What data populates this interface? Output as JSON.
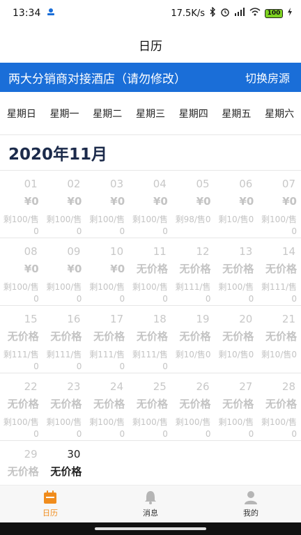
{
  "status_bar": {
    "time": "13:34",
    "network_speed": "17.5K/s",
    "battery": "100"
  },
  "nav": {
    "title": "日历"
  },
  "hotel": {
    "name": "两大分销商对接酒店（请勿修改）",
    "switch_label": "切换房源"
  },
  "weekdays": [
    "星期日",
    "星期一",
    "星期二",
    "星期三",
    "星期四",
    "星期五",
    "星期六"
  ],
  "month_title": "2020年11月",
  "days": [
    {
      "num": "01",
      "price": "¥0",
      "stock": "剩100/售0"
    },
    {
      "num": "02",
      "price": "¥0",
      "stock": "剩100/售0"
    },
    {
      "num": "03",
      "price": "¥0",
      "stock": "剩100/售0"
    },
    {
      "num": "04",
      "price": "¥0",
      "stock": "剩100/售0"
    },
    {
      "num": "05",
      "price": "¥0",
      "stock": "剩98/售0"
    },
    {
      "num": "06",
      "price": "¥0",
      "stock": "剩10/售0"
    },
    {
      "num": "07",
      "price": "¥0",
      "stock": "剩100/售0"
    },
    {
      "num": "08",
      "price": "¥0",
      "stock": "剩100/售0"
    },
    {
      "num": "09",
      "price": "¥0",
      "stock": "剩100/售0"
    },
    {
      "num": "10",
      "price": "¥0",
      "stock": "剩100/售0"
    },
    {
      "num": "11",
      "price": "无价格",
      "stock": "剩100/售0"
    },
    {
      "num": "12",
      "price": "无价格",
      "stock": "剩111/售0"
    },
    {
      "num": "13",
      "price": "无价格",
      "stock": "剩100/售0"
    },
    {
      "num": "14",
      "price": "无价格",
      "stock": "剩111/售0"
    },
    {
      "num": "15",
      "price": "无价格",
      "stock": "剩111/售0"
    },
    {
      "num": "16",
      "price": "无价格",
      "stock": "剩111/售0"
    },
    {
      "num": "17",
      "price": "无价格",
      "stock": "剩111/售0"
    },
    {
      "num": "18",
      "price": "无价格",
      "stock": "剩111/售0"
    },
    {
      "num": "19",
      "price": "无价格",
      "stock": "剩10/售0"
    },
    {
      "num": "20",
      "price": "无价格",
      "stock": "剩10/售0"
    },
    {
      "num": "21",
      "price": "无价格",
      "stock": "剩10/售0"
    },
    {
      "num": "22",
      "price": "无价格",
      "stock": "剩100/售0"
    },
    {
      "num": "23",
      "price": "无价格",
      "stock": "剩100/售0"
    },
    {
      "num": "24",
      "price": "无价格",
      "stock": "剩100/售0"
    },
    {
      "num": "25",
      "price": "无价格",
      "stock": "剩100/售0"
    },
    {
      "num": "26",
      "price": "无价格",
      "stock": "剩100/售0"
    },
    {
      "num": "27",
      "price": "无价格",
      "stock": "剩100/售0"
    },
    {
      "num": "28",
      "price": "无价格",
      "stock": "剩100/售0"
    },
    {
      "num": "29",
      "price": "无价格",
      "stock": ""
    },
    {
      "num": "30",
      "price": "无价格",
      "stock": "",
      "active": true
    }
  ],
  "tabs": [
    {
      "label": "日历",
      "icon": "calendar-icon",
      "active": true
    },
    {
      "label": "消息",
      "icon": "bell-icon",
      "active": false
    },
    {
      "label": "我的",
      "icon": "user-icon",
      "active": false
    }
  ],
  "colors": {
    "primary_blue": "#1a6ed8",
    "tab_active": "#f08c1c",
    "title_navy": "#1b2a4a"
  }
}
